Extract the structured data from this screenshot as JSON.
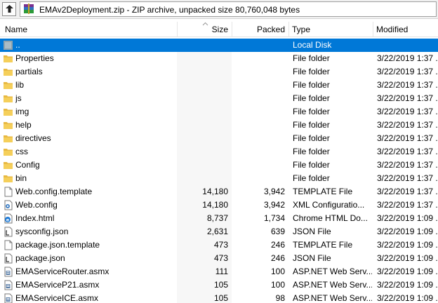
{
  "path_bar": {
    "path": "EMAv2Deployment.zip - ZIP archive, unpacked size 80,760,048 bytes"
  },
  "columns": {
    "name": "Name",
    "size": "Size",
    "packed": "Packed",
    "type": "Type",
    "modified": "Modified"
  },
  "colors": {
    "selection": "#0078d7",
    "folder": "#e8b942",
    "size_column_bg": "#f7f7f7"
  },
  "rows": [
    {
      "name": "..",
      "size": "",
      "packed": "",
      "type": "Local Disk",
      "modified": "",
      "icon": "up-folder-icon",
      "selected": true
    },
    {
      "name": "Properties",
      "size": "",
      "packed": "",
      "type": "File folder",
      "modified": "3/22/2019 1:37 ...",
      "icon": "folder-icon"
    },
    {
      "name": "partials",
      "size": "",
      "packed": "",
      "type": "File folder",
      "modified": "3/22/2019 1:37 ...",
      "icon": "folder-icon"
    },
    {
      "name": "lib",
      "size": "",
      "packed": "",
      "type": "File folder",
      "modified": "3/22/2019 1:37 ...",
      "icon": "folder-icon"
    },
    {
      "name": "js",
      "size": "",
      "packed": "",
      "type": "File folder",
      "modified": "3/22/2019 1:37 ...",
      "icon": "folder-icon"
    },
    {
      "name": "img",
      "size": "",
      "packed": "",
      "type": "File folder",
      "modified": "3/22/2019 1:37 ...",
      "icon": "folder-icon"
    },
    {
      "name": "help",
      "size": "",
      "packed": "",
      "type": "File folder",
      "modified": "3/22/2019 1:37 ...",
      "icon": "folder-icon"
    },
    {
      "name": "directives",
      "size": "",
      "packed": "",
      "type": "File folder",
      "modified": "3/22/2019 1:37 ...",
      "icon": "folder-icon"
    },
    {
      "name": "css",
      "size": "",
      "packed": "",
      "type": "File folder",
      "modified": "3/22/2019 1:37 ...",
      "icon": "folder-icon"
    },
    {
      "name": "Config",
      "size": "",
      "packed": "",
      "type": "File folder",
      "modified": "3/22/2019 1:37 ...",
      "icon": "folder-icon"
    },
    {
      "name": "bin",
      "size": "",
      "packed": "",
      "type": "File folder",
      "modified": "3/22/2019 1:37 ...",
      "icon": "folder-icon"
    },
    {
      "name": "Web.config.template",
      "size": "14,180",
      "packed": "3,942",
      "type": "TEMPLATE File",
      "modified": "3/22/2019 1:37 ...",
      "icon": "file-icon"
    },
    {
      "name": "Web.config",
      "size": "14,180",
      "packed": "3,942",
      "type": "XML Configuratio...",
      "modified": "3/22/2019 1:37 ...",
      "icon": "config-file-icon"
    },
    {
      "name": "Index.html",
      "size": "8,737",
      "packed": "1,734",
      "type": "Chrome HTML Do...",
      "modified": "3/22/2019 1:09 ...",
      "icon": "html-file-icon"
    },
    {
      "name": "sysconfig.json",
      "size": "2,631",
      "packed": "639",
      "type": "JSON File",
      "modified": "3/22/2019 1:09 ...",
      "icon": "json-file-icon"
    },
    {
      "name": "package.json.template",
      "size": "473",
      "packed": "246",
      "type": "TEMPLATE File",
      "modified": "3/22/2019 1:09 ...",
      "icon": "file-icon"
    },
    {
      "name": "package.json",
      "size": "473",
      "packed": "246",
      "type": "JSON File",
      "modified": "3/22/2019 1:09 ...",
      "icon": "json-file-icon"
    },
    {
      "name": "EMAServiceRouter.asmx",
      "size": "111",
      "packed": "100",
      "type": "ASP.NET Web Serv...",
      "modified": "3/22/2019 1:09 ...",
      "icon": "asmx-file-icon"
    },
    {
      "name": "EMAServiceP21.asmx",
      "size": "105",
      "packed": "100",
      "type": "ASP.NET Web Serv...",
      "modified": "3/22/2019 1:09 ...",
      "icon": "asmx-file-icon"
    },
    {
      "name": "EMAServiceICE.asmx",
      "size": "105",
      "packed": "98",
      "type": "ASP.NET Web Serv...",
      "modified": "3/22/2019 1:09 ...",
      "icon": "asmx-file-icon"
    }
  ]
}
